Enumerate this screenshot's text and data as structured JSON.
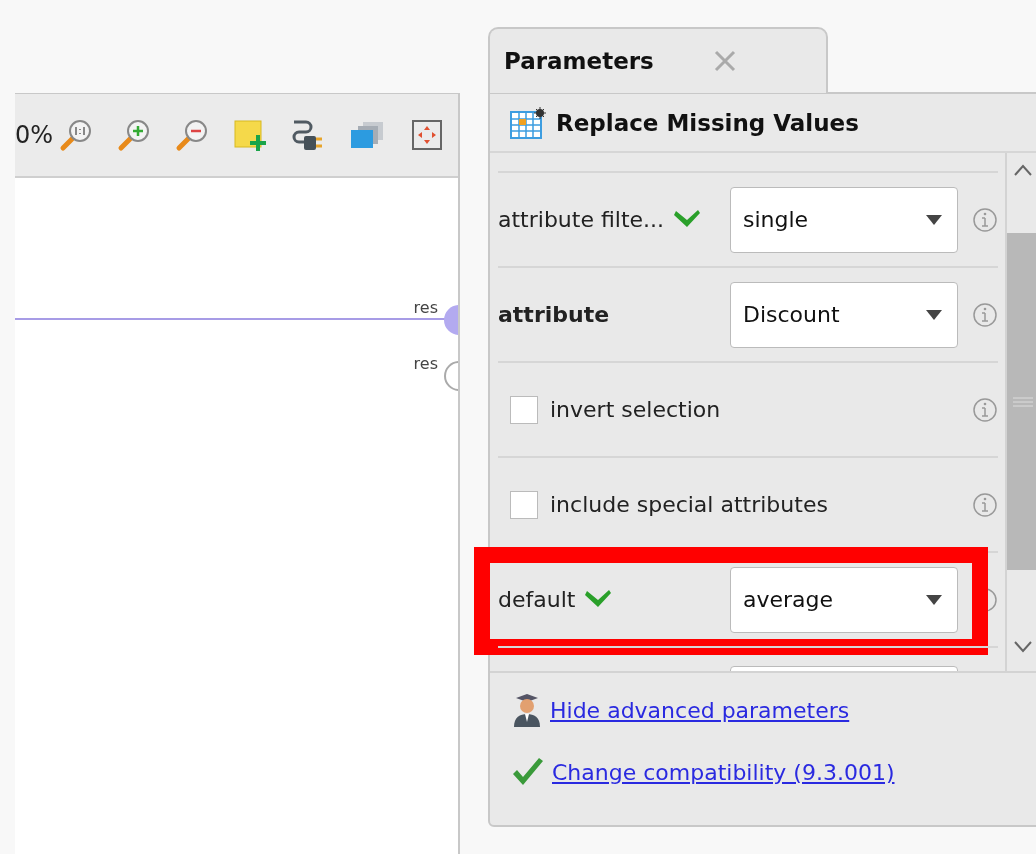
{
  "process_panel": {
    "toolbar": {
      "zoom_text": "0%"
    },
    "ports": [
      {
        "label": "res",
        "connected": true
      },
      {
        "label": "res",
        "connected": false
      }
    ]
  },
  "parameters_tab": {
    "title": "Parameters",
    "selected": true
  },
  "operator": {
    "title": "Replace Missing Values"
  },
  "rows": [
    {
      "kind": "select",
      "label": "attribute filte...",
      "validated": true,
      "required": false,
      "value": "single"
    },
    {
      "kind": "select",
      "label": "attribute",
      "validated": false,
      "required": true,
      "value": "Discount"
    },
    {
      "kind": "checkbox",
      "label": "invert selection",
      "checked": false
    },
    {
      "kind": "checkbox",
      "label": "include special attributes",
      "checked": false
    },
    {
      "kind": "select",
      "label": "default",
      "validated": true,
      "required": false,
      "value": "average",
      "highlighted": true
    },
    {
      "kind": "select"
    }
  ],
  "links": [
    {
      "kind": "advanced",
      "text": "Hide advanced parameters"
    },
    {
      "kind": "compatibility",
      "text": "Change compatibility (9.3.001)"
    }
  ]
}
